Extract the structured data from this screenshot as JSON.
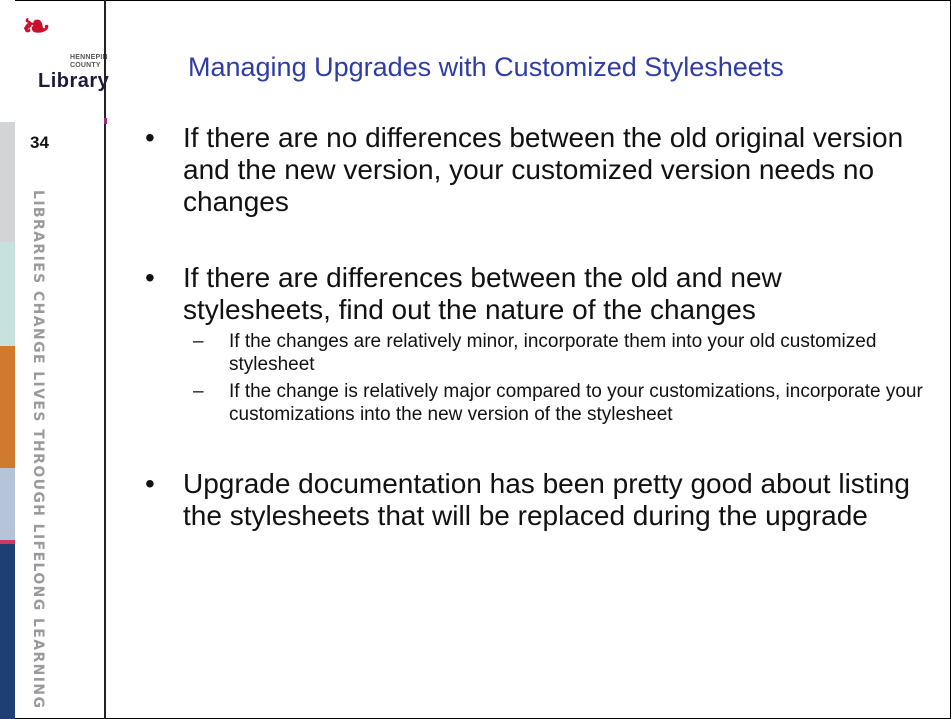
{
  "slide": {
    "title": "Managing Upgrades with Customized Stylesheets",
    "number": "34"
  },
  "logo": {
    "line1": "HENNEPIN",
    "line2": "COUNTY",
    "word": "Library"
  },
  "sidebar": {
    "tagline": "LIBRARIES CHANGE LIVES THROUGH LIFELONG LEARNING",
    "colors": [
      "#ffffff",
      "#d2d4d6",
      "#c6e1de",
      "#cf7a2e",
      "#b6c4d9",
      "#d0385f",
      "#1d3f73"
    ]
  },
  "bullets": [
    {
      "text": "If there are no differences between the old original version and the new version, your customized version needs no changes"
    },
    {
      "text": "If there are differences between the old and new stylesheets, find out the nature of the changes",
      "subs": [
        "If the changes are relatively minor, incorporate them into your old customized stylesheet",
        "If the change is relatively major compared to your customizations, incorporate your customizations into the new version of the stylesheet"
      ]
    },
    {
      "text": "Upgrade documentation has been pretty good about listing the stylesheets that will be replaced during the upgrade"
    }
  ],
  "colors": {
    "title": "#2e3ca6",
    "brand_red": "#c8102e"
  }
}
